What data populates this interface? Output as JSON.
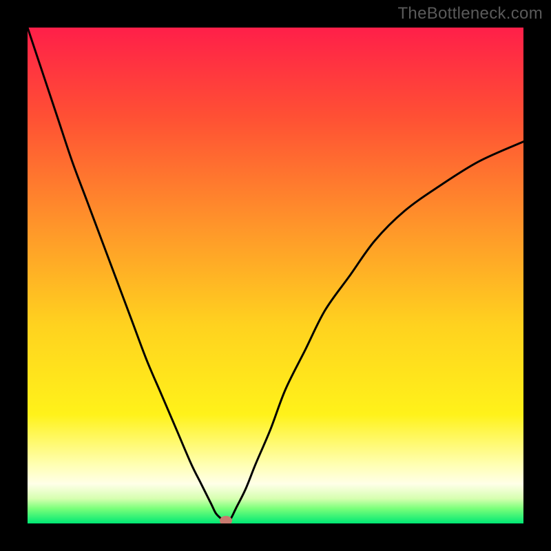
{
  "watermark": {
    "text": "TheBottleneck.com"
  },
  "chart_data": {
    "type": "line",
    "title": "",
    "xlabel": "",
    "ylabel": "",
    "xlim": [
      0,
      100
    ],
    "ylim": [
      0,
      100
    ],
    "grid": false,
    "legend": false,
    "gradient_stops": [
      {
        "pct": 0,
        "color": "#ff1f49"
      },
      {
        "pct": 18,
        "color": "#ff5034"
      },
      {
        "pct": 40,
        "color": "#ff952a"
      },
      {
        "pct": 60,
        "color": "#ffd21f"
      },
      {
        "pct": 78,
        "color": "#fff21a"
      },
      {
        "pct": 88,
        "color": "#ffffb0"
      },
      {
        "pct": 92,
        "color": "#ffffe8"
      },
      {
        "pct": 95,
        "color": "#d6ffb0"
      },
      {
        "pct": 97,
        "color": "#7aff7a"
      },
      {
        "pct": 100,
        "color": "#00e874"
      }
    ],
    "series": [
      {
        "name": "bottleneck-curve",
        "x": [
          0,
          3,
          6,
          9,
          12,
          15,
          18,
          21,
          24,
          27,
          30,
          33,
          35,
          37,
          38,
          39,
          40,
          41,
          42,
          44,
          46,
          49,
          52,
          56,
          60,
          65,
          70,
          76,
          83,
          91,
          100
        ],
        "y": [
          100,
          91,
          82,
          73,
          65,
          57,
          49,
          41,
          33,
          26,
          19,
          12,
          8,
          4,
          2,
          1,
          0,
          1,
          3,
          7,
          12,
          19,
          27,
          35,
          43,
          50,
          57,
          63,
          68,
          73,
          77
        ]
      }
    ],
    "marker": {
      "x": 40,
      "y": 0,
      "color": "#c97a6f"
    }
  }
}
